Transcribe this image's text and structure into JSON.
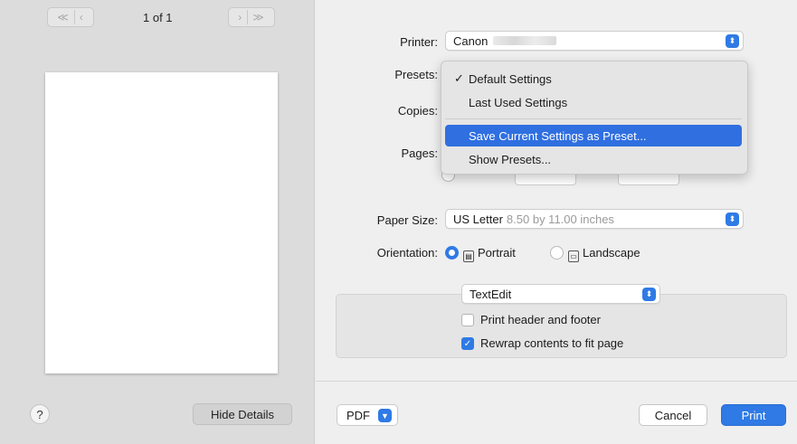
{
  "preview": {
    "first_prev_glyphs": [
      "≪",
      "‹"
    ],
    "next_last_glyphs": [
      "›",
      "≫"
    ],
    "page_count": "1 of 1",
    "help_label": "?",
    "hide_details_label": "Hide Details"
  },
  "printer": {
    "label": "Printer:",
    "value": "Canon",
    "icon": "up-down-stepper-icon"
  },
  "presets": {
    "label": "Presets:",
    "menu_items": [
      {
        "label": "Default Settings",
        "checked": true,
        "highlighted": false
      },
      {
        "label": "Last Used Settings",
        "checked": false,
        "highlighted": false
      },
      {
        "label": "Save Current Settings as Preset...",
        "checked": false,
        "highlighted": true
      },
      {
        "label": "Show Presets...",
        "checked": false,
        "highlighted": false
      }
    ]
  },
  "copies": {
    "label": "Copies:"
  },
  "pages": {
    "label": "Pages:"
  },
  "paper_size": {
    "label": "Paper Size:",
    "value": "US Letter",
    "dimensions": "8.50 by 11.00 inches"
  },
  "orientation": {
    "label": "Orientation:",
    "options": [
      {
        "label": "Portrait",
        "selected": true
      },
      {
        "label": "Landscape",
        "selected": false
      }
    ]
  },
  "app_section": {
    "selector_value": "TextEdit",
    "options": [
      {
        "label": "Print header and footer",
        "checked": false
      },
      {
        "label": "Rewrap contents to fit page",
        "checked": true
      }
    ]
  },
  "footer": {
    "pdf_label": "PDF",
    "cancel_label": "Cancel",
    "print_label": "Print"
  },
  "colors": {
    "accent": "#2f7ae5",
    "menu_highlight": "#2f6fe0"
  }
}
